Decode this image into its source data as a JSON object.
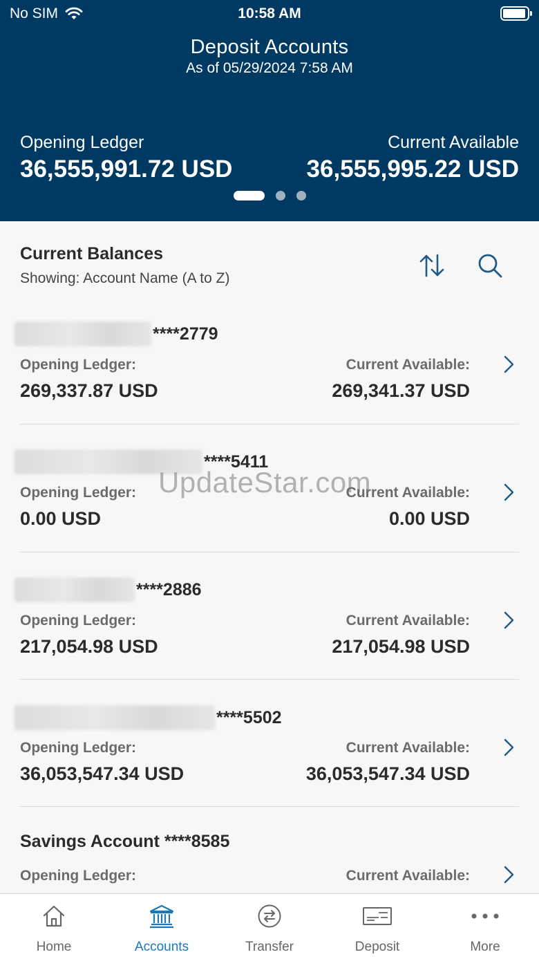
{
  "status_bar": {
    "carrier": "No SIM",
    "time": "10:58 AM"
  },
  "header": {
    "title": "Deposit Accounts",
    "as_of": "As of 05/29/2024 7:58 AM",
    "opening_ledger_label": "Opening Ledger",
    "opening_ledger_value": "36,555,991.72 USD",
    "current_available_label": "Current Available",
    "current_available_value": "36,555,995.22 USD",
    "pager": {
      "count": 3,
      "active_index": 0
    }
  },
  "balances": {
    "title": "Current Balances",
    "showing": "Showing: Account Name (A to Z)",
    "sort_icon": "sort-icon",
    "search_icon": "search-icon"
  },
  "accounts": [
    {
      "name": "****2779",
      "opening_label": "Opening Ledger:",
      "opening": "269,337.87 USD",
      "available_label": "Current Available:",
      "available": "269,341.37 USD"
    },
    {
      "name": "****5411",
      "opening_label": "Opening Ledger:",
      "opening": "0.00 USD",
      "available_label": "Current Available:",
      "available": "0.00 USD"
    },
    {
      "name": "****2886",
      "opening_label": "Opening Ledger:",
      "opening": "217,054.98 USD",
      "available_label": "Current Available:",
      "available": "217,054.98 USD"
    },
    {
      "name": "****5502",
      "opening_label": "Opening Ledger:",
      "opening": "36,053,547.34 USD",
      "available_label": "Current Available:",
      "available": "36,053,547.34 USD"
    },
    {
      "name": "Savings Account ****8585",
      "opening_label": "Opening Ledger:",
      "available_label": "Current Available:"
    }
  ],
  "watermark": "UpdateStar.com",
  "tabs": [
    {
      "label": "Home",
      "icon": "home-icon"
    },
    {
      "label": "Accounts",
      "icon": "bank-icon",
      "active": true
    },
    {
      "label": "Transfer",
      "icon": "transfer-icon"
    },
    {
      "label": "Deposit",
      "icon": "check-deposit-icon"
    },
    {
      "label": "More",
      "icon": "more-icon"
    }
  ],
  "colors": {
    "header_bg": "#003a63",
    "accent": "#1a78b8"
  }
}
